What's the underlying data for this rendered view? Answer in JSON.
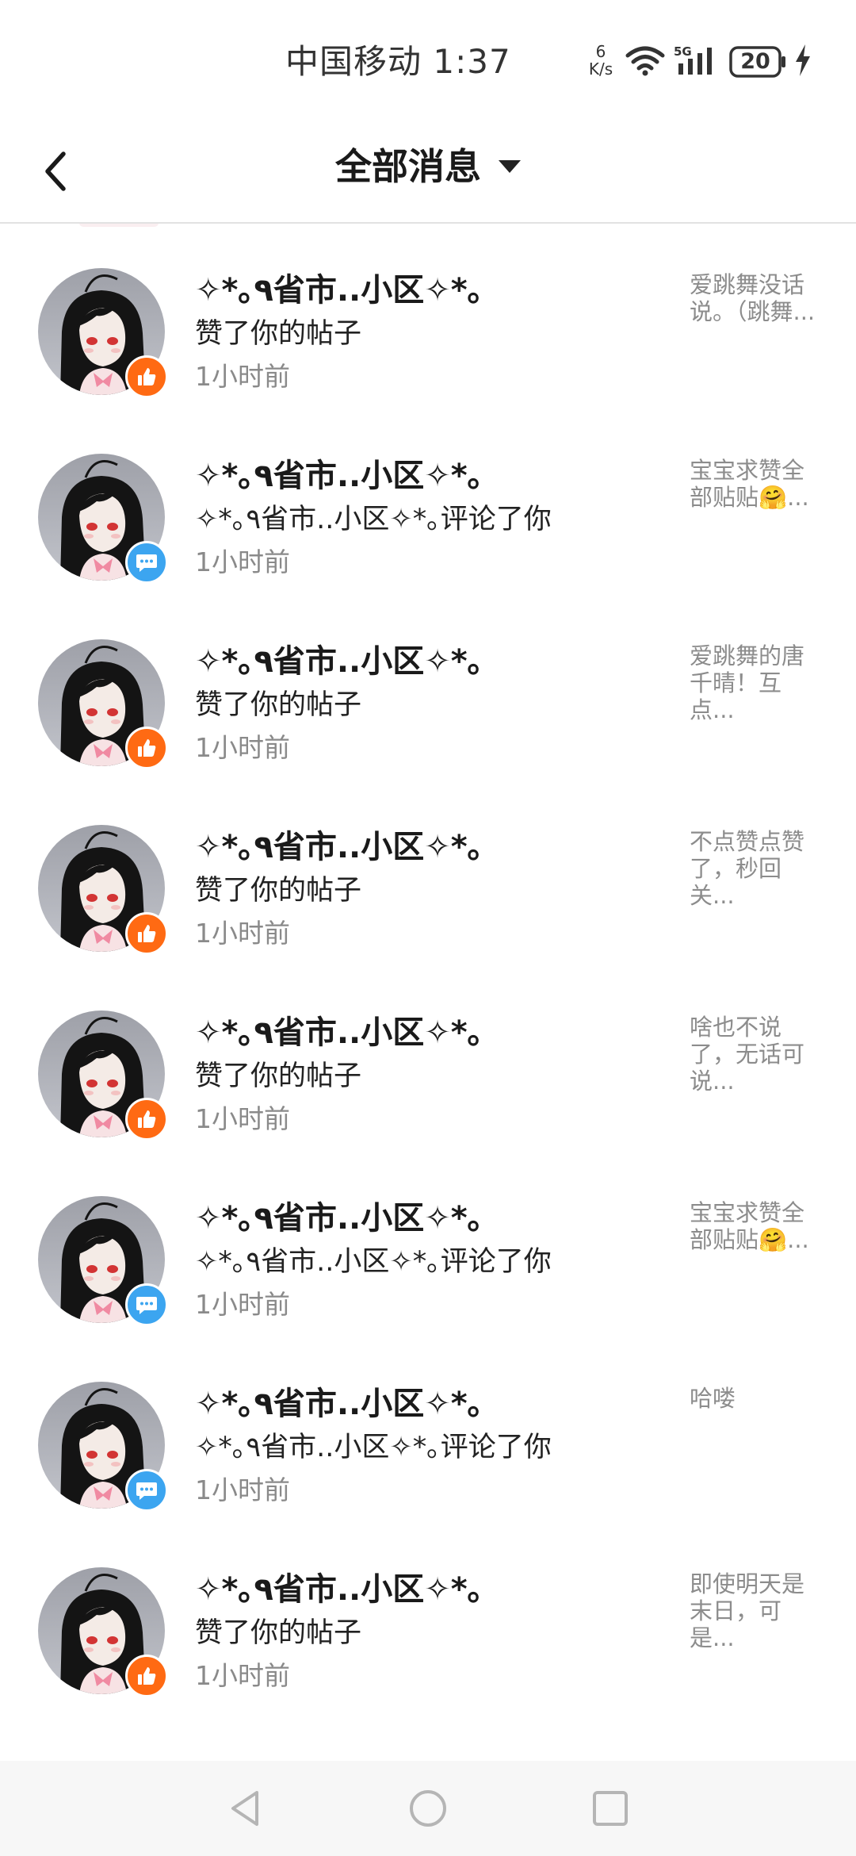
{
  "status_bar": {
    "carrier_time": "中国移动 1:37",
    "speed_value": "6",
    "speed_unit": "K/s",
    "signal_label": "5G",
    "battery": "20",
    "icons": [
      "wifi-icon",
      "signal-icon",
      "battery-icon",
      "charging-icon"
    ]
  },
  "header": {
    "title": "全部消息",
    "back_icon": "back-chevron-icon",
    "dropdown_icon": "caret-down-icon"
  },
  "colors": {
    "like_badge": "#ff6a13",
    "comment_badge": "#3ca5f0",
    "time_text": "#8a8a8a",
    "preview_text": "#8c8c8c"
  },
  "messages": [
    {
      "title": "✧*｡٩省市..小区✧*｡",
      "action": "赞了你的帖子",
      "time": "1小时前",
      "type": "like",
      "badge_icon": "thumbs-up-icon",
      "preview": "爱跳舞没话说。（跳舞..."
    },
    {
      "title": "✧*｡٩省市..小区✧*｡",
      "action": "✧*｡٩省市..小区✧*｡评论了你",
      "time": "1小时前",
      "type": "comment",
      "badge_icon": "comment-icon",
      "preview": "宝宝求赞全部贴贴🤗..."
    },
    {
      "title": "✧*｡٩省市..小区✧*｡",
      "action": "赞了你的帖子",
      "time": "1小时前",
      "type": "like",
      "badge_icon": "thumbs-up-icon",
      "preview": "爱跳舞的唐千晴！互点..."
    },
    {
      "title": "✧*｡٩省市..小区✧*｡",
      "action": "赞了你的帖子",
      "time": "1小时前",
      "type": "like",
      "badge_icon": "thumbs-up-icon",
      "preview": "不点赞点赞了，秒回关..."
    },
    {
      "title": "✧*｡٩省市..小区✧*｡",
      "action": "赞了你的帖子",
      "time": "1小时前",
      "type": "like",
      "badge_icon": "thumbs-up-icon",
      "preview": "啥也不说了，无话可说..."
    },
    {
      "title": "✧*｡٩省市..小区✧*｡",
      "action": "✧*｡٩省市..小区✧*｡评论了你",
      "time": "1小时前",
      "type": "comment",
      "badge_icon": "comment-icon",
      "preview": "宝宝求赞全部贴贴🤗..."
    },
    {
      "title": "✧*｡٩省市..小区✧*｡",
      "action": "✧*｡٩省市..小区✧*｡评论了你",
      "time": "1小时前",
      "type": "comment",
      "badge_icon": "comment-icon",
      "preview": "哈喽"
    },
    {
      "title": "✧*｡٩省市..小区✧*｡",
      "action": "赞了你的帖子",
      "time": "1小时前",
      "type": "like",
      "badge_icon": "thumbs-up-icon",
      "preview": "即使明天是末日，可是..."
    }
  ],
  "nav_bar": {
    "buttons": [
      "back-triangle-icon",
      "home-circle-icon",
      "recents-square-icon"
    ]
  }
}
